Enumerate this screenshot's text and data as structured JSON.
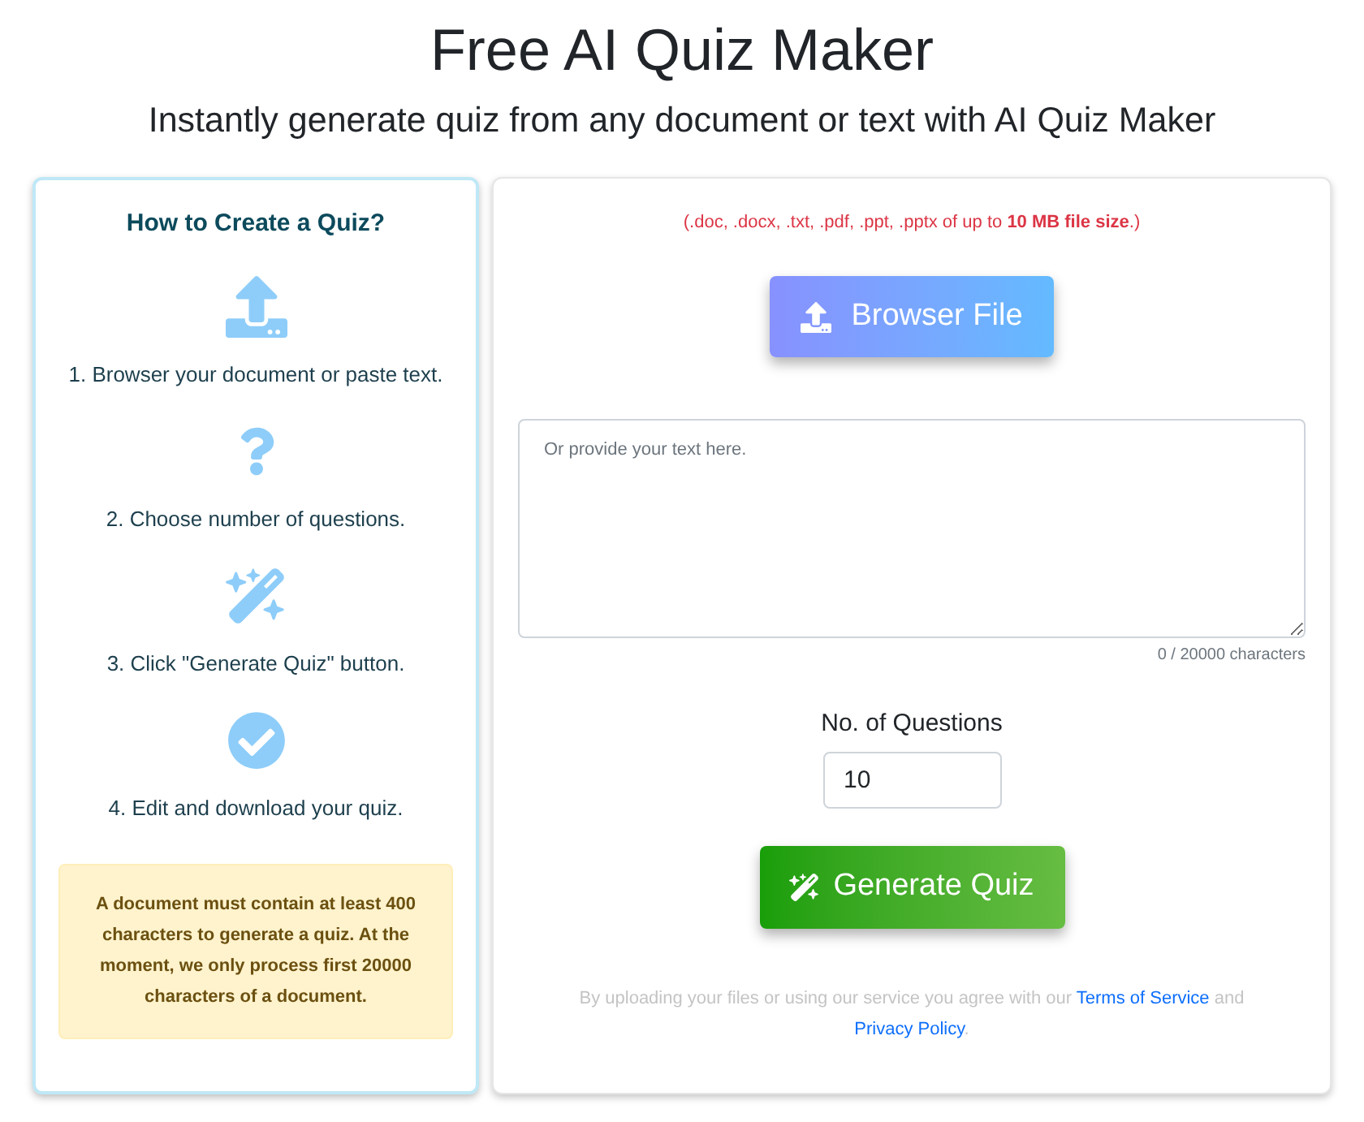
{
  "header": {
    "title": "Free AI Quiz Maker",
    "subtitle": "Instantly generate quiz from any document or text with AI Quiz Maker"
  },
  "steps_card": {
    "title": "How to Create a Quiz?",
    "steps": [
      {
        "kind": "upload",
        "text": "1. Browser your document or paste text."
      },
      {
        "kind": "question",
        "text": "2. Choose number of questions."
      },
      {
        "kind": "wand",
        "text": "3. Click \"Generate Quiz\" button."
      },
      {
        "kind": "check",
        "text": "4. Edit and download your quiz."
      }
    ],
    "notice": "A document must contain at least 400 characters to generate a quiz. At the moment, we only process first 20000 characters of a document."
  },
  "upload_card": {
    "file_types_note": "(.doc, .docx, .txt, .pdf, .ppt, .pptx of up to **10 MB file size**.)",
    "browse_button": "Browser File",
    "text_area": {
      "placeholder": "Or provide your text here.",
      "counter": "0 / 20000 characters"
    },
    "questions_field": {
      "label": "No. of Questions",
      "value": "10"
    },
    "generate_button": "Generate Quiz",
    "consent": [
      {
        "kind": "text",
        "text": "By uploading your files or using our service you agree with our"
      },
      {
        "kind": "link",
        "text": "Terms of Service"
      },
      {
        "kind": "text",
        "text": "and"
      },
      {
        "kind": "link",
        "text": "Privacy Policy"
      },
      {
        "kind": "punct",
        "text": "."
      }
    ]
  }
}
